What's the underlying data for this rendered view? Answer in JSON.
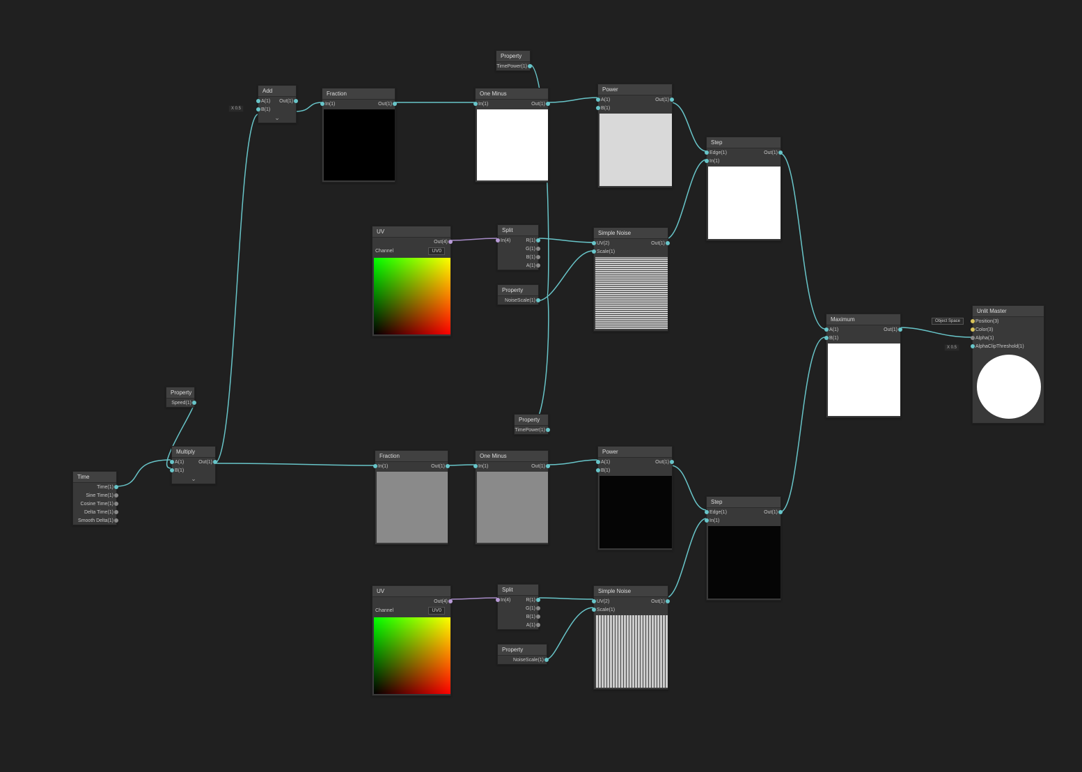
{
  "nodes": {
    "time": {
      "title": "Time",
      "outs": [
        "Time(1)",
        "Sine Time(1)",
        "Cosine Time(1)",
        "Delta Time(1)",
        "Smooth Delta(1)"
      ]
    },
    "propSpeed": {
      "title": "Property",
      "out": "Speed(1)"
    },
    "multiply": {
      "title": "Multiply",
      "a": "A(1)",
      "b": "B(1)",
      "out": "Out(1)"
    },
    "add": {
      "title": "Add",
      "a": "A(1)",
      "b": "B(1)",
      "out": "Out(1)",
      "xfield": "X 0.5"
    },
    "fraction1": {
      "title": "Fraction",
      "in": "In(1)",
      "out": "Out(1)"
    },
    "fraction2": {
      "title": "Fraction",
      "in": "In(1)",
      "out": "Out(1)"
    },
    "oneMinus1": {
      "title": "One Minus",
      "in": "In(1)",
      "out": "Out(1)"
    },
    "oneMinus2": {
      "title": "One Minus",
      "in": "In(1)",
      "out": "Out(1)"
    },
    "propTimePower1": {
      "title": "Property",
      "out": "TimePower(1)"
    },
    "propTimePower2": {
      "title": "Property",
      "out": "TimePower(1)"
    },
    "power1": {
      "title": "Power",
      "a": "A(1)",
      "b": "B(1)",
      "out": "Out(1)"
    },
    "power2": {
      "title": "Power",
      "a": "A(1)",
      "b": "B(1)",
      "out": "Out(1)"
    },
    "uv1": {
      "title": "UV",
      "out": "Out(4)",
      "channelLabel": "Channel",
      "channel": "UV0"
    },
    "uv2": {
      "title": "UV",
      "out": "Out(4)",
      "channelLabel": "Channel",
      "channel": "UV0"
    },
    "split1": {
      "title": "Split",
      "in": "In(4)",
      "r": "R(1)",
      "g": "G(1)",
      "b": "B(1)",
      "a": "A(1)"
    },
    "split2": {
      "title": "Split",
      "in": "In(4)",
      "r": "R(1)",
      "g": "G(1)",
      "b": "B(1)",
      "a": "A(1)"
    },
    "propNoiseScale1": {
      "title": "Property",
      "out": "NoiseScale(1)"
    },
    "propNoiseScale2": {
      "title": "Property",
      "out": "NoiseScale(1)"
    },
    "noise1": {
      "title": "Simple Noise",
      "uv": "UV(2)",
      "scale": "Scale(1)",
      "out": "Out(1)"
    },
    "noise2": {
      "title": "Simple Noise",
      "uv": "UV(2)",
      "scale": "Scale(1)",
      "out": "Out(1)"
    },
    "step1": {
      "title": "Step",
      "edge": "Edge(1)",
      "in": "In(1)",
      "out": "Out(1)"
    },
    "step2": {
      "title": "Step",
      "edge": "Edge(1)",
      "in": "In(1)",
      "out": "Out(1)"
    },
    "maximum": {
      "title": "Maximum",
      "a": "A(1)",
      "b": "B(1)",
      "out": "Out(1)"
    },
    "master": {
      "title": "Unlit Master",
      "space": "Object Space",
      "pos": "Position(3)",
      "color": "Color(3)",
      "alpha": "Alpha(1)",
      "alphaclip": "AlphaClipThreshold(1)",
      "xfield": "X 0.5"
    }
  },
  "colors": {
    "wire": "#68c5c9",
    "wirePurple": "#a78bc7"
  }
}
